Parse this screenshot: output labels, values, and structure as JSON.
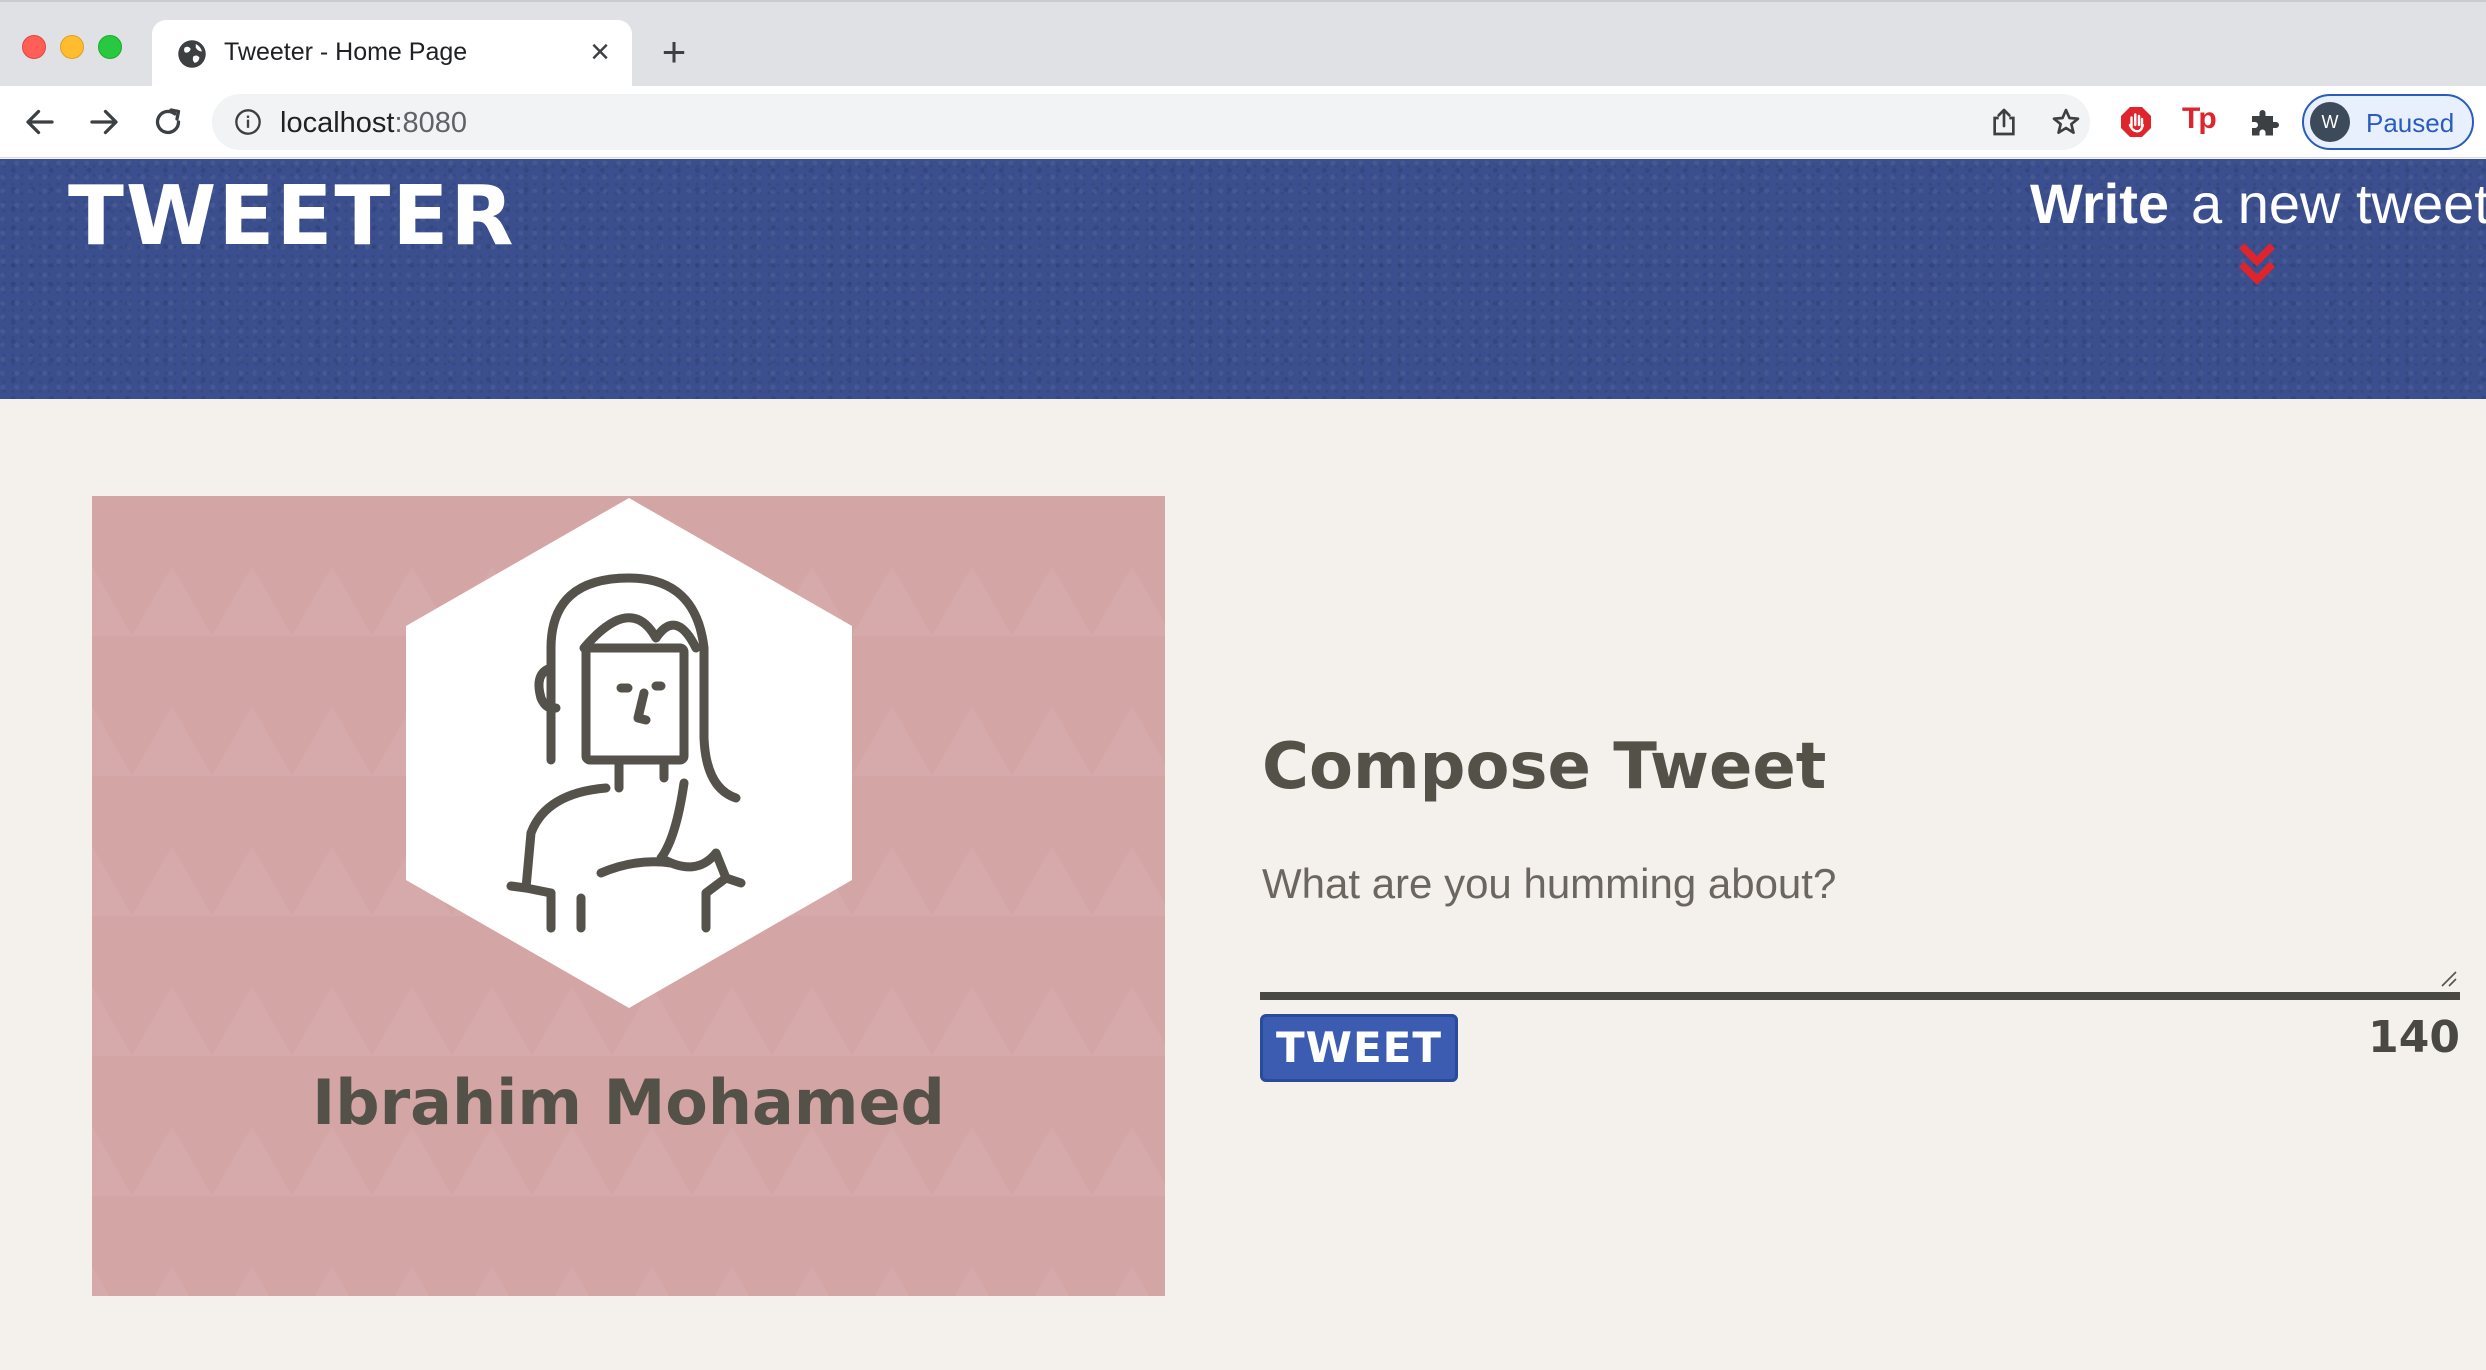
{
  "browser": {
    "tab_title": "Tweeter - Home Page",
    "tab_close": "×",
    "new_tab": "+",
    "url_host": "localhost",
    "url_port": ":8080",
    "profile_initial": "W",
    "profile_label": "Paused",
    "icons": [
      "globe-icon",
      "back-arrow-icon",
      "forward-arrow-icon",
      "reload-icon",
      "info-icon",
      "share-icon",
      "bookmark-star-icon",
      "adblock-icon",
      "tp-extension-icon",
      "extensions-puzzle-icon"
    ]
  },
  "header": {
    "logo": "TWEETER",
    "write_strong": "Write",
    "write_rest": "a new tweet",
    "chevron_color": "#e0242b"
  },
  "profile": {
    "name": "Ibrahim Mohamed",
    "avatar_icon": "person-avatar-icon"
  },
  "compose": {
    "title": "Compose Tweet",
    "placeholder": "What are you humming about?",
    "value": "",
    "button_label": "TWEET",
    "counter": "140"
  },
  "colors": {
    "header_bg": "#3b4f8e",
    "card_bg": "#d4a5a5",
    "page_bg": "#f4f1ec",
    "text": "#545149",
    "button_bg": "#3b5cb0"
  }
}
